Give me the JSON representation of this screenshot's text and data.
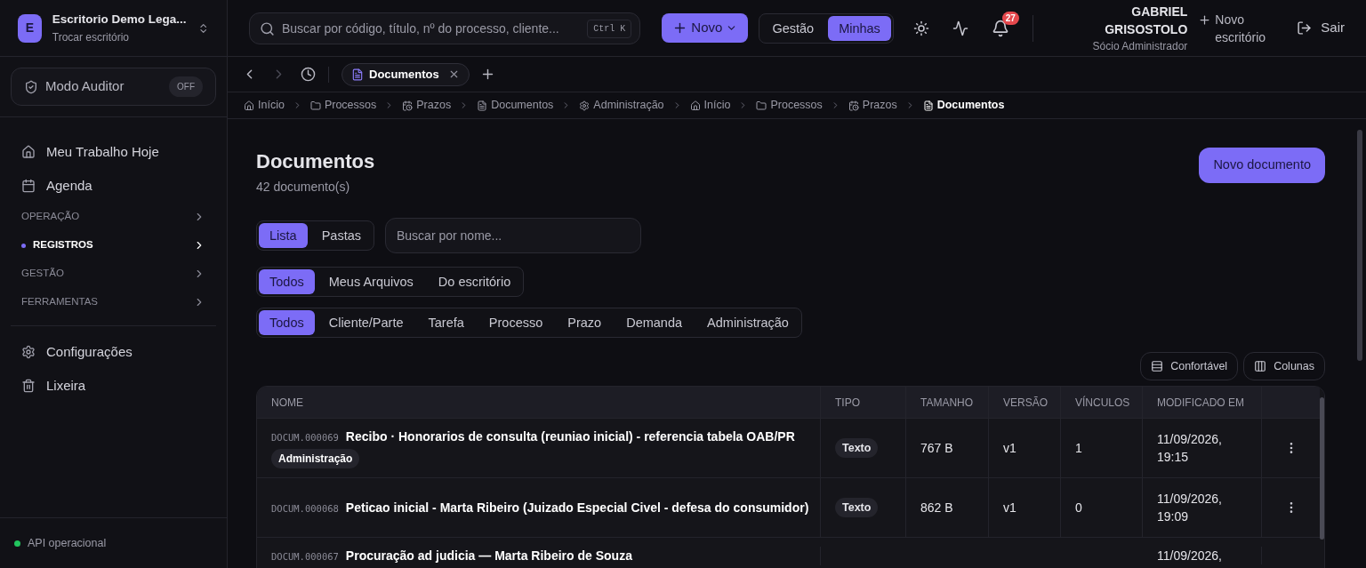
{
  "org": {
    "initial": "E",
    "name": "Escritorio Demo Lega...",
    "subtitle": "Trocar escritório"
  },
  "auditor": {
    "label": "Modo Auditor",
    "toggle": "OFF",
    "on": false
  },
  "nav": [
    {
      "kind": "link",
      "label": "Meu Trabalho Hoje",
      "selected": false
    },
    {
      "kind": "link",
      "label": "Agenda",
      "selected": false
    },
    {
      "kind": "section",
      "label": "OPERAÇÃO",
      "selected": false
    },
    {
      "kind": "section",
      "label": "REGISTROS",
      "selected": true
    },
    {
      "kind": "section",
      "label": "GESTÃO",
      "selected": false
    },
    {
      "kind": "section",
      "label": "FERRAMENTAS",
      "selected": false
    },
    {
      "kind": "link",
      "label": "Configurações",
      "selected": false
    },
    {
      "kind": "link",
      "label": "Lixeira",
      "selected": false
    }
  ],
  "status": {
    "label": "API operacional",
    "color": "#22c55e"
  },
  "search": {
    "placeholder": "Buscar por código, título, nº do processo, cliente...",
    "shortcut": "Ctrl K"
  },
  "new_button": "Novo",
  "scope": [
    {
      "label": "Gestão",
      "selected": false
    },
    {
      "label": "Minhas",
      "selected": true
    }
  ],
  "notifications": "27",
  "user": {
    "name": "GABRIEL GRISOSTOLO",
    "role": "Sócio Administrador"
  },
  "new_office": "Novo escritório",
  "logout": "Sair",
  "tabs": [
    {
      "label": "Documentos",
      "selected": true
    }
  ],
  "breadcrumbs": [
    "Início",
    "Processos",
    "Prazos",
    "Documentos",
    "Administração",
    "Início",
    "Processos",
    "Prazos",
    "Documentos"
  ],
  "page": {
    "title": "Documentos",
    "count": "42 documento(s)",
    "action": "Novo documento"
  },
  "view_toggle": [
    {
      "label": "Lista",
      "selected": true
    },
    {
      "label": "Pastas",
      "selected": false
    }
  ],
  "name_search": {
    "placeholder": "Buscar por nome..."
  },
  "owner_filter": [
    {
      "label": "Todos",
      "selected": true
    },
    {
      "label": "Meus Arquivos",
      "selected": false
    },
    {
      "label": "Do escritório",
      "selected": false
    }
  ],
  "category_filter": [
    {
      "label": "Todos",
      "selected": true
    },
    {
      "label": "Cliente/Parte",
      "selected": false
    },
    {
      "label": "Tarefa",
      "selected": false
    },
    {
      "label": "Processo",
      "selected": false
    },
    {
      "label": "Prazo",
      "selected": false
    },
    {
      "label": "Demanda",
      "selected": false
    },
    {
      "label": "Administração",
      "selected": false
    }
  ],
  "density": "Confortável",
  "columns_button": "Colunas",
  "table": {
    "columns": [
      "NOME",
      "TIPO",
      "TAMANHO",
      "VERSÃO",
      "VÍNCULOS",
      "MODIFICADO EM"
    ],
    "rows": [
      {
        "code": "DOCUM.000069",
        "name": "Recibo · Honorarios de consulta (reuniao inicial) - referencia tabela OAB/PR",
        "tag": "Administração",
        "type": "Texto",
        "size": "767 B",
        "version": "v1",
        "links": "1",
        "modified": "11/09/2026, 19:15"
      },
      {
        "code": "DOCUM.000068",
        "name": "Peticao inicial - Marta Ribeiro (Juizado Especial Civel - defesa do consumidor)",
        "type": "Texto",
        "size": "862 B",
        "version": "v1",
        "links": "0",
        "modified": "11/09/2026, 19:09"
      },
      {
        "code": "DOCUM.000067",
        "name": "Procuração ad judicia — Marta Ribeiro de Souza",
        "modified": "11/09/2026,"
      }
    ]
  }
}
